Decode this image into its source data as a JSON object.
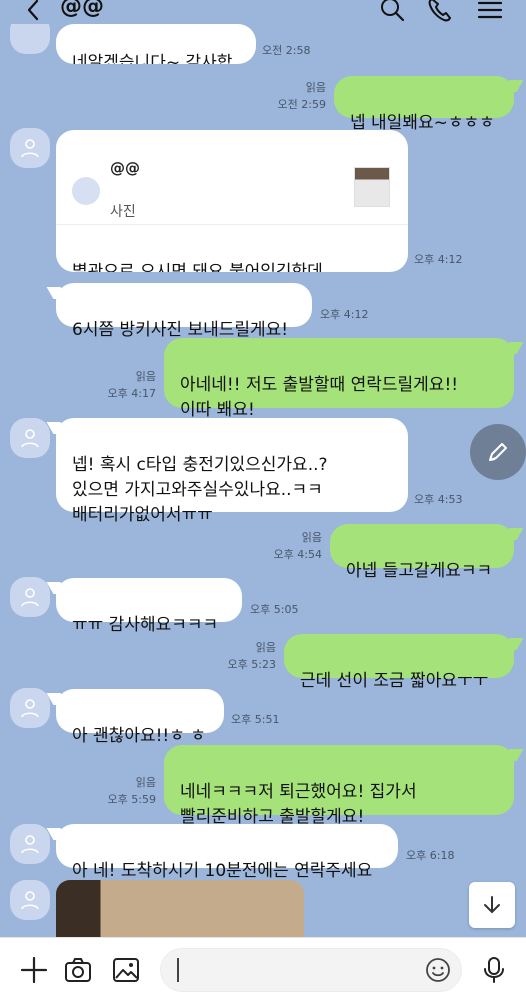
{
  "header": {
    "title": "@@"
  },
  "messages": [
    {
      "id": "m0",
      "text": "네알겠습니다~ 감사합니다",
      "time": "오전 2:58"
    },
    {
      "id": "m1",
      "text": "넵 내일봬요~ㅎㅎㅎ",
      "read": "읽음",
      "time": "오전 2:59"
    },
    {
      "id": "m2",
      "card_name": "@@",
      "card_sub": "사진",
      "text": "별관으로 오시면 돼요 붙어있긴한데\n본관별관이 따로 잇나봐용",
      "time": "오후 4:12"
    },
    {
      "id": "m3",
      "text": "6시쯤 방키사진 보내드릴게요!",
      "time": "오후 4:12"
    },
    {
      "id": "m4",
      "text": "아네네!! 저도 출발할때 연락드릴게요!!\n이따 봬요!",
      "read": "읽음",
      "time": "오후 4:17"
    },
    {
      "id": "m5",
      "text": "넵! 혹시 c타입 충전기있으신가요..?\n있으면 가지고와주실수있나요..ㅋㅋ\n배터리가없어서ㅠㅠ",
      "time": "오후 4:53"
    },
    {
      "id": "m6",
      "text": "아넵 들고갈게요ㅋㅋ",
      "read": "읽음",
      "time": "오후 4:54"
    },
    {
      "id": "m7",
      "text": "ㅠㅠ 감사해요ㅋㅋㅋ",
      "time": "오후 5:05"
    },
    {
      "id": "m8",
      "text": "근데 선이 조금 짧아요ㅜㅜ",
      "read": "읽음",
      "time": "오후 5:23"
    },
    {
      "id": "m9",
      "text": "아 괜찮아요!!ㅎ ㅎ",
      "time": "오후 5:51"
    },
    {
      "id": "m10",
      "text": "네네ㅋㅋㅋ저 퇴근했어요! 집가서\n빨리준비하고 출발할게요!",
      "read": "읽음",
      "time": "오후 5:59"
    },
    {
      "id": "m11",
      "text": "아 네! 도착하시기 10분전에는 연락주세요",
      "time": "오후 6:18"
    }
  ],
  "icons": {
    "back": "chevron-left-icon",
    "search": "search-icon",
    "call": "phone-icon",
    "menu": "menu-icon",
    "edit": "pencil-icon",
    "scroll_down": "arrow-down-icon",
    "plus": "plus-icon",
    "camera": "camera-icon",
    "gallery": "image-icon",
    "emoji": "emoji-icon",
    "mic": "microphone-icon"
  },
  "colors": {
    "background": "#9bb6da",
    "incoming": "#ffffff",
    "outgoing": "#a6e27a"
  }
}
